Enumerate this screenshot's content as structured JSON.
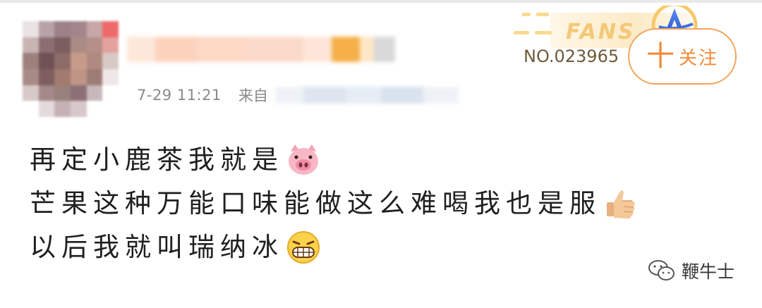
{
  "post": {
    "timestamp": "7-29 11:21",
    "source_label": "来自",
    "lines": [
      "再定小鹿茶我就是",
      "芒果这种万能口味能做这么难喝我也是服",
      "以后我就叫瑞纳冰"
    ],
    "line_emojis": [
      "pig-face-emoji",
      "thumbs-up-emoji",
      "grinning-face-emoji"
    ]
  },
  "badge": {
    "fans_text": "FANS",
    "number": "NO.023965"
  },
  "follow": {
    "plus": "十",
    "label": "关注"
  },
  "watermark": {
    "name": "鞭牛士"
  },
  "colors": {
    "accent": "#f08a3a",
    "badge_gold": "#f4c877",
    "text": "#1f1f1f",
    "meta": "#8a8a8a"
  }
}
